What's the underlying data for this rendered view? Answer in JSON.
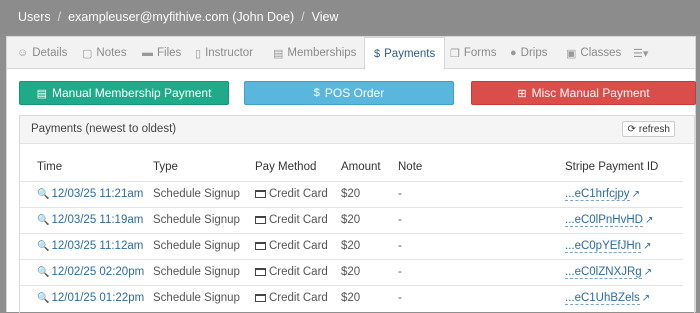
{
  "breadcrumb": {
    "root": "Users",
    "user": "exampleuser@myfithive.com (John Doe)",
    "current": "View",
    "separator": "/"
  },
  "tabs": [
    {
      "label": "Details",
      "icon": "user-circle-icon",
      "glyph": "☺"
    },
    {
      "label": "Notes",
      "icon": "note-icon",
      "glyph": "▢"
    },
    {
      "label": "Files",
      "icon": "folder-icon",
      "glyph": "▬"
    },
    {
      "label": "Instructor",
      "icon": "id-badge-icon",
      "glyph": "▯"
    },
    {
      "label": "Memberships",
      "icon": "id-card-icon",
      "glyph": "▤"
    },
    {
      "label": "Payments",
      "icon": "dollar-icon",
      "glyph": "$",
      "active": true
    },
    {
      "label": "Forms",
      "icon": "copy-icon",
      "glyph": "❐"
    },
    {
      "label": "Drips",
      "icon": "tint-icon",
      "glyph": "●"
    },
    {
      "label": "Classes",
      "icon": "calendar-icon",
      "glyph": "▣"
    },
    {
      "label": "",
      "icon": "menu-dropdown-icon",
      "glyph": "☰▾"
    }
  ],
  "actions": {
    "manual_membership": "Manual Membership Payment",
    "pos_order": "POS Order",
    "misc_manual": "Misc Manual Payment"
  },
  "payments": {
    "title": "Payments (newest to oldest)",
    "refresh_label": "refresh",
    "columns": [
      "Time",
      "Type",
      "Pay Method",
      "Amount",
      "Note",
      "Stripe Payment ID"
    ],
    "rows": [
      {
        "time": "12/03/25 11:21am",
        "type": "Schedule Signup",
        "method": "Credit Card",
        "amount": "$20",
        "note": "-",
        "stripe_id": "...eC1hrfcjpy"
      },
      {
        "time": "12/03/25 11:19am",
        "type": "Schedule Signup",
        "method": "Credit Card",
        "amount": "$20",
        "note": "-",
        "stripe_id": "...eC0lPnHvHD"
      },
      {
        "time": "12/03/25 11:12am",
        "type": "Schedule Signup",
        "method": "Credit Card",
        "amount": "$20",
        "note": "-",
        "stripe_id": "...eC0pYEfJHn"
      },
      {
        "time": "12/02/25 02:20pm",
        "type": "Schedule Signup",
        "method": "Credit Card",
        "amount": "$20",
        "note": "-",
        "stripe_id": "...eC0lZNXJRg"
      },
      {
        "time": "12/01/25 01:22pm",
        "type": "Schedule Signup",
        "method": "Credit Card",
        "amount": "$20",
        "note": "-",
        "stripe_id": "...eC1UhBZels"
      }
    ]
  },
  "colors": {
    "green": "#1fab89",
    "blue": "#59b6dd",
    "red": "#d94e4a",
    "link": "#2c6aa0"
  }
}
